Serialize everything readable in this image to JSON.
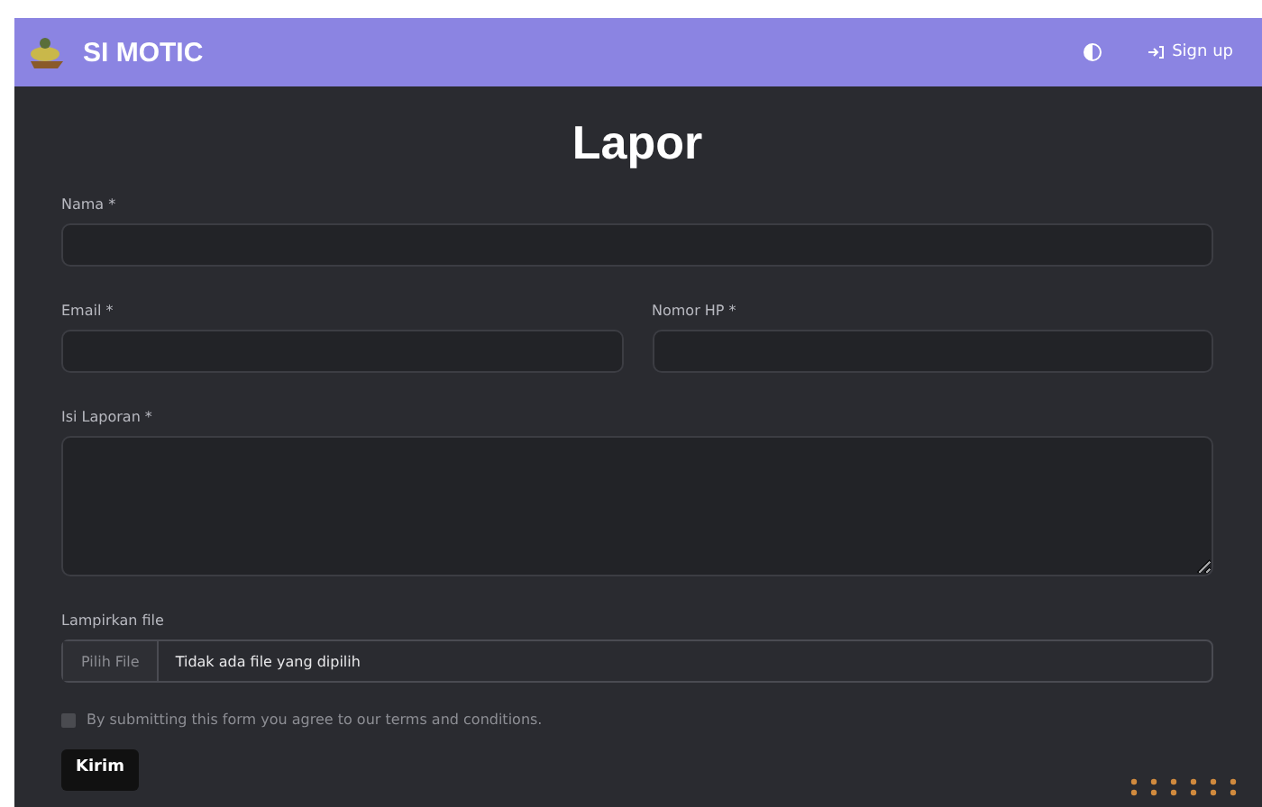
{
  "navbar": {
    "brand": "SI MOTIC",
    "signup": "Sign up"
  },
  "title": "Lapor",
  "fields": [
    {
      "label": "Nama *",
      "kind": "text",
      "half": false
    },
    {
      "label": "Email *",
      "kind": "text",
      "half": true
    },
    {
      "label": "Nomor HP *",
      "kind": "text",
      "half": true
    },
    {
      "label": "Isi Laporan *",
      "kind": "textarea",
      "half": false
    }
  ],
  "file": {
    "label": "Lampirkan file",
    "button": "Pilih File",
    "status": "Tidak ada file yang dipilih"
  },
  "agree": {
    "text": "By submitting this form you agree to our terms and conditions.",
    "checked": false
  },
  "submit": "Kirim"
}
